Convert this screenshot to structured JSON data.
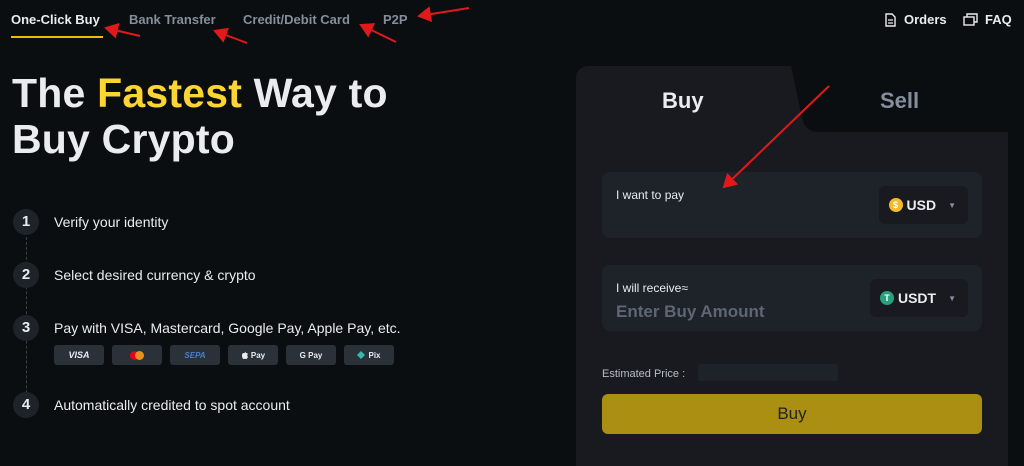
{
  "nav": {
    "tabs": [
      {
        "label": "One-Click Buy",
        "active": true
      },
      {
        "label": "Bank Transfer",
        "active": false
      },
      {
        "label": "Credit/Debit Card",
        "active": false
      },
      {
        "label": "P2P",
        "active": false
      }
    ],
    "orders_label": "Orders",
    "faq_label": "FAQ"
  },
  "hero": {
    "line1_pre": "The ",
    "line1_highlight": "Fastest",
    "line1_post": " Way to",
    "line2": "Buy Crypto"
  },
  "steps": [
    {
      "num": "1",
      "text": "Verify your identity"
    },
    {
      "num": "2",
      "text": "Select desired currency & crypto"
    },
    {
      "num": "3",
      "text": "Pay with VISA, Mastercard, Google Pay, Apple Pay, etc."
    },
    {
      "num": "4",
      "text": "Automatically credited to spot account"
    }
  ],
  "payment_methods": [
    "VISA",
    "",
    "SEPA",
    "Pay",
    "G Pay",
    "Pix"
  ],
  "panel": {
    "buy_tab": "Buy",
    "sell_tab": "Sell",
    "pay_field": {
      "label": "I want to pay",
      "value": "",
      "currency": "USD"
    },
    "receive_field": {
      "label": "I will receive≈",
      "placeholder": "Enter Buy Amount",
      "currency": "USDT"
    },
    "estimated_price_label": "Estimated Price :",
    "buy_button": "Buy"
  },
  "colors": {
    "accent": "#fcd535",
    "background": "#0b0e11",
    "panel": "#181a20",
    "button": "#ab8f12",
    "annotation_arrow": "#e0191b"
  }
}
